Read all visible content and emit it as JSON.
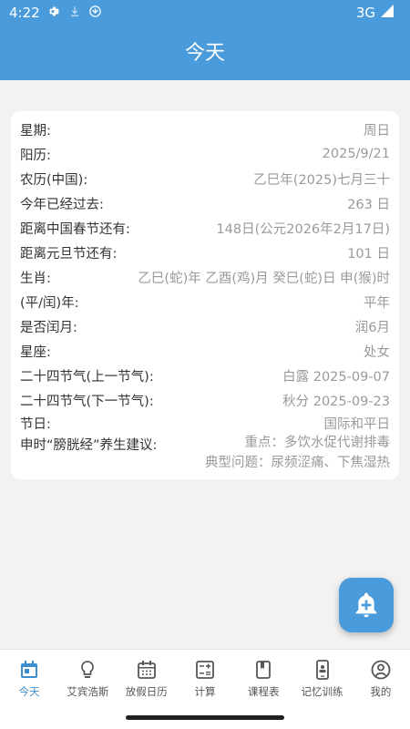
{
  "status_bar": {
    "time": "4:22",
    "network": "3G"
  },
  "header": {
    "title": "今天"
  },
  "info_rows": [
    {
      "label": "星期:",
      "value": "周日"
    },
    {
      "label": "阳历:",
      "value": "2025/9/21"
    },
    {
      "label": "农历(中国):",
      "value": "乙巳年(2025)七月三十"
    },
    {
      "label": "今年已经过去:",
      "value": "263 日"
    },
    {
      "label": "距离中国春节还有:",
      "value": "148日(公元2026年2月17日)"
    },
    {
      "label": "距离元旦节还有:",
      "value": "101 日"
    },
    {
      "label": "生肖:",
      "value": "乙巳(蛇)年 乙酉(鸡)月 癸巳(蛇)日 申(猴)时"
    },
    {
      "label": "(平/闰)年:",
      "value": "平年"
    },
    {
      "label": "是否闰月:",
      "value": "润6月"
    },
    {
      "label": "星座:",
      "value": "处女"
    },
    {
      "label": "二十四节气(上一节气):",
      "value": "白露 2025-09-07"
    },
    {
      "label": "二十四节气(下一节气):",
      "value": "秋分 2025-09-23"
    },
    {
      "label": "节日:",
      "value": "国际和平日"
    }
  ],
  "advice": {
    "label": "申时“膀胱经”养生建议:",
    "line1": "重点：多饮水促代谢排毒",
    "line2": "典型问题：尿频涩痛、下焦湿热"
  },
  "nav": [
    {
      "label": "今天",
      "icon": "calendar-today-icon",
      "active": true
    },
    {
      "label": "艾宾浩斯",
      "icon": "lightbulb-icon"
    },
    {
      "label": "放假日历",
      "icon": "calendar-grid-icon"
    },
    {
      "label": "计算",
      "icon": "calculator-icon"
    },
    {
      "label": "课程表",
      "icon": "book-icon"
    },
    {
      "label": "记忆训练",
      "icon": "phone-badge-icon"
    },
    {
      "label": "我的",
      "icon": "account-circle-icon"
    }
  ],
  "colors": {
    "primary": "#4a9bdb",
    "active_nav": "#3e8ed0"
  }
}
